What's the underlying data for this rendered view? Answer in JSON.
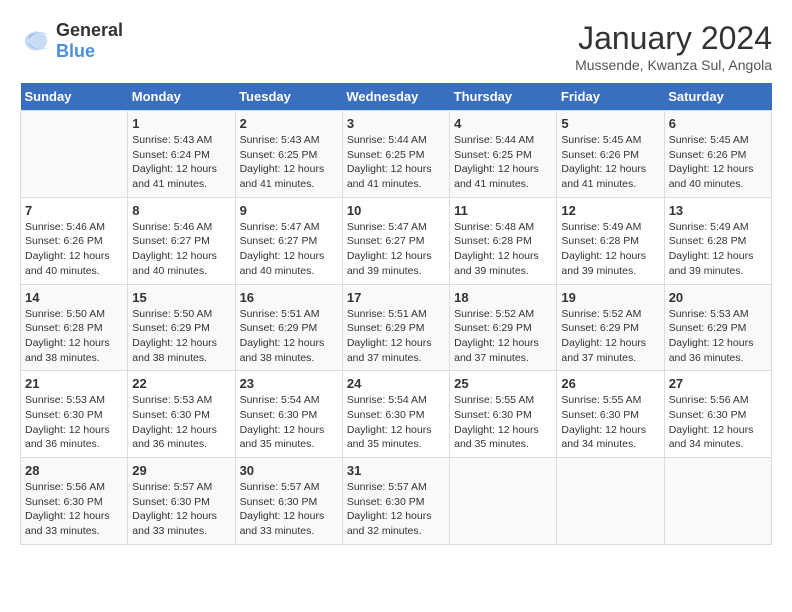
{
  "logo": {
    "general": "General",
    "blue": "Blue"
  },
  "header": {
    "month_year": "January 2024",
    "location": "Mussende, Kwanza Sul, Angola"
  },
  "weekdays": [
    "Sunday",
    "Monday",
    "Tuesday",
    "Wednesday",
    "Thursday",
    "Friday",
    "Saturday"
  ],
  "weeks": [
    [
      {
        "day": "",
        "sunrise": "",
        "sunset": "",
        "daylight": ""
      },
      {
        "day": "1",
        "sunrise": "Sunrise: 5:43 AM",
        "sunset": "Sunset: 6:24 PM",
        "daylight": "Daylight: 12 hours and 41 minutes."
      },
      {
        "day": "2",
        "sunrise": "Sunrise: 5:43 AM",
        "sunset": "Sunset: 6:25 PM",
        "daylight": "Daylight: 12 hours and 41 minutes."
      },
      {
        "day": "3",
        "sunrise": "Sunrise: 5:44 AM",
        "sunset": "Sunset: 6:25 PM",
        "daylight": "Daylight: 12 hours and 41 minutes."
      },
      {
        "day": "4",
        "sunrise": "Sunrise: 5:44 AM",
        "sunset": "Sunset: 6:25 PM",
        "daylight": "Daylight: 12 hours and 41 minutes."
      },
      {
        "day": "5",
        "sunrise": "Sunrise: 5:45 AM",
        "sunset": "Sunset: 6:26 PM",
        "daylight": "Daylight: 12 hours and 41 minutes."
      },
      {
        "day": "6",
        "sunrise": "Sunrise: 5:45 AM",
        "sunset": "Sunset: 6:26 PM",
        "daylight": "Daylight: 12 hours and 40 minutes."
      }
    ],
    [
      {
        "day": "7",
        "sunrise": "Sunrise: 5:46 AM",
        "sunset": "Sunset: 6:26 PM",
        "daylight": "Daylight: 12 hours and 40 minutes."
      },
      {
        "day": "8",
        "sunrise": "Sunrise: 5:46 AM",
        "sunset": "Sunset: 6:27 PM",
        "daylight": "Daylight: 12 hours and 40 minutes."
      },
      {
        "day": "9",
        "sunrise": "Sunrise: 5:47 AM",
        "sunset": "Sunset: 6:27 PM",
        "daylight": "Daylight: 12 hours and 40 minutes."
      },
      {
        "day": "10",
        "sunrise": "Sunrise: 5:47 AM",
        "sunset": "Sunset: 6:27 PM",
        "daylight": "Daylight: 12 hours and 39 minutes."
      },
      {
        "day": "11",
        "sunrise": "Sunrise: 5:48 AM",
        "sunset": "Sunset: 6:28 PM",
        "daylight": "Daylight: 12 hours and 39 minutes."
      },
      {
        "day": "12",
        "sunrise": "Sunrise: 5:49 AM",
        "sunset": "Sunset: 6:28 PM",
        "daylight": "Daylight: 12 hours and 39 minutes."
      },
      {
        "day": "13",
        "sunrise": "Sunrise: 5:49 AM",
        "sunset": "Sunset: 6:28 PM",
        "daylight": "Daylight: 12 hours and 39 minutes."
      }
    ],
    [
      {
        "day": "14",
        "sunrise": "Sunrise: 5:50 AM",
        "sunset": "Sunset: 6:28 PM",
        "daylight": "Daylight: 12 hours and 38 minutes."
      },
      {
        "day": "15",
        "sunrise": "Sunrise: 5:50 AM",
        "sunset": "Sunset: 6:29 PM",
        "daylight": "Daylight: 12 hours and 38 minutes."
      },
      {
        "day": "16",
        "sunrise": "Sunrise: 5:51 AM",
        "sunset": "Sunset: 6:29 PM",
        "daylight": "Daylight: 12 hours and 38 minutes."
      },
      {
        "day": "17",
        "sunrise": "Sunrise: 5:51 AM",
        "sunset": "Sunset: 6:29 PM",
        "daylight": "Daylight: 12 hours and 37 minutes."
      },
      {
        "day": "18",
        "sunrise": "Sunrise: 5:52 AM",
        "sunset": "Sunset: 6:29 PM",
        "daylight": "Daylight: 12 hours and 37 minutes."
      },
      {
        "day": "19",
        "sunrise": "Sunrise: 5:52 AM",
        "sunset": "Sunset: 6:29 PM",
        "daylight": "Daylight: 12 hours and 37 minutes."
      },
      {
        "day": "20",
        "sunrise": "Sunrise: 5:53 AM",
        "sunset": "Sunset: 6:29 PM",
        "daylight": "Daylight: 12 hours and 36 minutes."
      }
    ],
    [
      {
        "day": "21",
        "sunrise": "Sunrise: 5:53 AM",
        "sunset": "Sunset: 6:30 PM",
        "daylight": "Daylight: 12 hours and 36 minutes."
      },
      {
        "day": "22",
        "sunrise": "Sunrise: 5:53 AM",
        "sunset": "Sunset: 6:30 PM",
        "daylight": "Daylight: 12 hours and 36 minutes."
      },
      {
        "day": "23",
        "sunrise": "Sunrise: 5:54 AM",
        "sunset": "Sunset: 6:30 PM",
        "daylight": "Daylight: 12 hours and 35 minutes."
      },
      {
        "day": "24",
        "sunrise": "Sunrise: 5:54 AM",
        "sunset": "Sunset: 6:30 PM",
        "daylight": "Daylight: 12 hours and 35 minutes."
      },
      {
        "day": "25",
        "sunrise": "Sunrise: 5:55 AM",
        "sunset": "Sunset: 6:30 PM",
        "daylight": "Daylight: 12 hours and 35 minutes."
      },
      {
        "day": "26",
        "sunrise": "Sunrise: 5:55 AM",
        "sunset": "Sunset: 6:30 PM",
        "daylight": "Daylight: 12 hours and 34 minutes."
      },
      {
        "day": "27",
        "sunrise": "Sunrise: 5:56 AM",
        "sunset": "Sunset: 6:30 PM",
        "daylight": "Daylight: 12 hours and 34 minutes."
      }
    ],
    [
      {
        "day": "28",
        "sunrise": "Sunrise: 5:56 AM",
        "sunset": "Sunset: 6:30 PM",
        "daylight": "Daylight: 12 hours and 33 minutes."
      },
      {
        "day": "29",
        "sunrise": "Sunrise: 5:57 AM",
        "sunset": "Sunset: 6:30 PM",
        "daylight": "Daylight: 12 hours and 33 minutes."
      },
      {
        "day": "30",
        "sunrise": "Sunrise: 5:57 AM",
        "sunset": "Sunset: 6:30 PM",
        "daylight": "Daylight: 12 hours and 33 minutes."
      },
      {
        "day": "31",
        "sunrise": "Sunrise: 5:57 AM",
        "sunset": "Sunset: 6:30 PM",
        "daylight": "Daylight: 12 hours and 32 minutes."
      },
      {
        "day": "",
        "sunrise": "",
        "sunset": "",
        "daylight": ""
      },
      {
        "day": "",
        "sunrise": "",
        "sunset": "",
        "daylight": ""
      },
      {
        "day": "",
        "sunrise": "",
        "sunset": "",
        "daylight": ""
      }
    ]
  ]
}
